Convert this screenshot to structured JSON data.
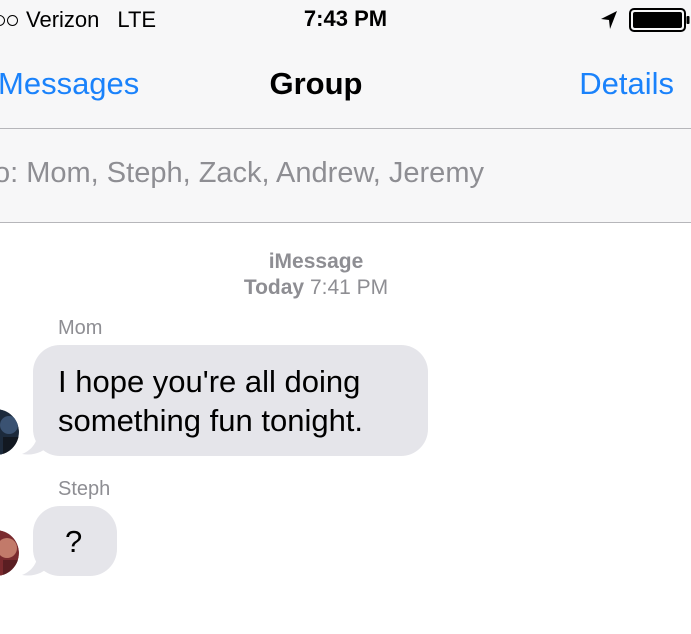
{
  "status_bar": {
    "carrier": "Verizon",
    "network": "LTE",
    "time": "7:43 PM"
  },
  "nav": {
    "back_label": "Messages",
    "title": "Group",
    "details_label": "Details"
  },
  "to_bar": {
    "recipients_text": "o: Mom, Steph, Zack, Andrew, Jeremy"
  },
  "conversation": {
    "service": "iMessage",
    "timestamp_day": "Today",
    "timestamp_time": "7:41 PM",
    "messages": [
      {
        "sender": "Mom",
        "line1": "I hope you're all doing",
        "line2": "something fun tonight."
      },
      {
        "sender": "Steph",
        "text": "?"
      }
    ]
  },
  "colors": {
    "accent": "#1a82fb",
    "received_bubble": "#e5e5ea",
    "secondary_text": "#8e8e93",
    "header_background": "#f7f7f8"
  },
  "icons": [
    "location-arrow-icon",
    "battery-icon"
  ]
}
